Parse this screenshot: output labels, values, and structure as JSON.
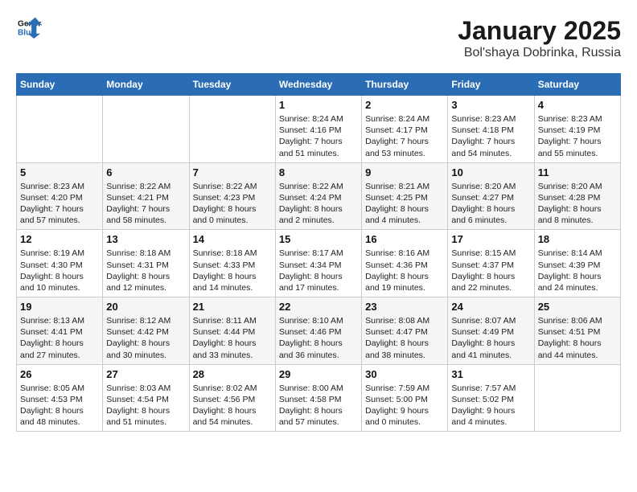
{
  "header": {
    "logo_line1": "General",
    "logo_line2": "Blue",
    "month": "January 2025",
    "location": "Bol'shaya Dobrinka, Russia"
  },
  "weekdays": [
    "Sunday",
    "Monday",
    "Tuesday",
    "Wednesday",
    "Thursday",
    "Friday",
    "Saturday"
  ],
  "weeks": [
    [
      {
        "day": "",
        "info": ""
      },
      {
        "day": "",
        "info": ""
      },
      {
        "day": "",
        "info": ""
      },
      {
        "day": "1",
        "info": "Sunrise: 8:24 AM\nSunset: 4:16 PM\nDaylight: 7 hours\nand 51 minutes."
      },
      {
        "day": "2",
        "info": "Sunrise: 8:24 AM\nSunset: 4:17 PM\nDaylight: 7 hours\nand 53 minutes."
      },
      {
        "day": "3",
        "info": "Sunrise: 8:23 AM\nSunset: 4:18 PM\nDaylight: 7 hours\nand 54 minutes."
      },
      {
        "day": "4",
        "info": "Sunrise: 8:23 AM\nSunset: 4:19 PM\nDaylight: 7 hours\nand 55 minutes."
      }
    ],
    [
      {
        "day": "5",
        "info": "Sunrise: 8:23 AM\nSunset: 4:20 PM\nDaylight: 7 hours\nand 57 minutes."
      },
      {
        "day": "6",
        "info": "Sunrise: 8:22 AM\nSunset: 4:21 PM\nDaylight: 7 hours\nand 58 minutes."
      },
      {
        "day": "7",
        "info": "Sunrise: 8:22 AM\nSunset: 4:23 PM\nDaylight: 8 hours\nand 0 minutes."
      },
      {
        "day": "8",
        "info": "Sunrise: 8:22 AM\nSunset: 4:24 PM\nDaylight: 8 hours\nand 2 minutes."
      },
      {
        "day": "9",
        "info": "Sunrise: 8:21 AM\nSunset: 4:25 PM\nDaylight: 8 hours\nand 4 minutes."
      },
      {
        "day": "10",
        "info": "Sunrise: 8:20 AM\nSunset: 4:27 PM\nDaylight: 8 hours\nand 6 minutes."
      },
      {
        "day": "11",
        "info": "Sunrise: 8:20 AM\nSunset: 4:28 PM\nDaylight: 8 hours\nand 8 minutes."
      }
    ],
    [
      {
        "day": "12",
        "info": "Sunrise: 8:19 AM\nSunset: 4:30 PM\nDaylight: 8 hours\nand 10 minutes."
      },
      {
        "day": "13",
        "info": "Sunrise: 8:18 AM\nSunset: 4:31 PM\nDaylight: 8 hours\nand 12 minutes."
      },
      {
        "day": "14",
        "info": "Sunrise: 8:18 AM\nSunset: 4:33 PM\nDaylight: 8 hours\nand 14 minutes."
      },
      {
        "day": "15",
        "info": "Sunrise: 8:17 AM\nSunset: 4:34 PM\nDaylight: 8 hours\nand 17 minutes."
      },
      {
        "day": "16",
        "info": "Sunrise: 8:16 AM\nSunset: 4:36 PM\nDaylight: 8 hours\nand 19 minutes."
      },
      {
        "day": "17",
        "info": "Sunrise: 8:15 AM\nSunset: 4:37 PM\nDaylight: 8 hours\nand 22 minutes."
      },
      {
        "day": "18",
        "info": "Sunrise: 8:14 AM\nSunset: 4:39 PM\nDaylight: 8 hours\nand 24 minutes."
      }
    ],
    [
      {
        "day": "19",
        "info": "Sunrise: 8:13 AM\nSunset: 4:41 PM\nDaylight: 8 hours\nand 27 minutes."
      },
      {
        "day": "20",
        "info": "Sunrise: 8:12 AM\nSunset: 4:42 PM\nDaylight: 8 hours\nand 30 minutes."
      },
      {
        "day": "21",
        "info": "Sunrise: 8:11 AM\nSunset: 4:44 PM\nDaylight: 8 hours\nand 33 minutes."
      },
      {
        "day": "22",
        "info": "Sunrise: 8:10 AM\nSunset: 4:46 PM\nDaylight: 8 hours\nand 36 minutes."
      },
      {
        "day": "23",
        "info": "Sunrise: 8:08 AM\nSunset: 4:47 PM\nDaylight: 8 hours\nand 38 minutes."
      },
      {
        "day": "24",
        "info": "Sunrise: 8:07 AM\nSunset: 4:49 PM\nDaylight: 8 hours\nand 41 minutes."
      },
      {
        "day": "25",
        "info": "Sunrise: 8:06 AM\nSunset: 4:51 PM\nDaylight: 8 hours\nand 44 minutes."
      }
    ],
    [
      {
        "day": "26",
        "info": "Sunrise: 8:05 AM\nSunset: 4:53 PM\nDaylight: 8 hours\nand 48 minutes."
      },
      {
        "day": "27",
        "info": "Sunrise: 8:03 AM\nSunset: 4:54 PM\nDaylight: 8 hours\nand 51 minutes."
      },
      {
        "day": "28",
        "info": "Sunrise: 8:02 AM\nSunset: 4:56 PM\nDaylight: 8 hours\nand 54 minutes."
      },
      {
        "day": "29",
        "info": "Sunrise: 8:00 AM\nSunset: 4:58 PM\nDaylight: 8 hours\nand 57 minutes."
      },
      {
        "day": "30",
        "info": "Sunrise: 7:59 AM\nSunset: 5:00 PM\nDaylight: 9 hours\nand 0 minutes."
      },
      {
        "day": "31",
        "info": "Sunrise: 7:57 AM\nSunset: 5:02 PM\nDaylight: 9 hours\nand 4 minutes."
      },
      {
        "day": "",
        "info": ""
      }
    ]
  ]
}
